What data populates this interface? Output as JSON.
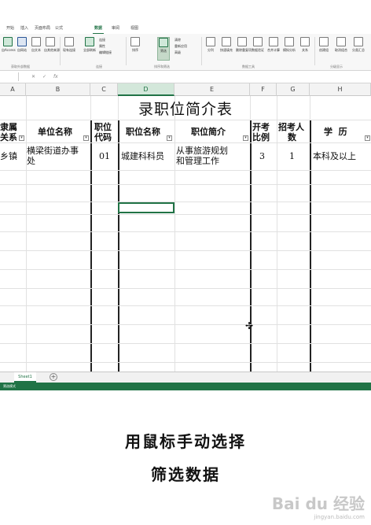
{
  "ribbon": {
    "tabs": [
      "开始",
      "插入",
      "页面布局",
      "公式",
      "数据",
      "审阅",
      "视图"
    ],
    "active_tab": "数据",
    "buttons": [
      {
        "label": "自Access"
      },
      {
        "label": "自网站"
      },
      {
        "label": "自文本"
      },
      {
        "label": "自其他来源"
      },
      {
        "label": "现有连接"
      },
      {
        "label": "全部刷新"
      },
      {
        "label": "排序"
      },
      {
        "label": "筛选"
      },
      {
        "label": "分列"
      },
      {
        "label": "快速填充"
      },
      {
        "label": "删除重复项"
      },
      {
        "label": "数据验证"
      },
      {
        "label": "合并计算"
      },
      {
        "label": "模拟分析"
      },
      {
        "label": "关系"
      },
      {
        "label": "创建组"
      },
      {
        "label": "取消组合"
      },
      {
        "label": "分类汇总"
      }
    ],
    "small_items": [
      "连接",
      "属性",
      "编辑链接",
      "清除",
      "重新应用",
      "高级"
    ],
    "group_labels": [
      "获取外部数据",
      "连接",
      "排序和筛选",
      "数据工具",
      "分级显示"
    ]
  },
  "formula_bar": {
    "fx": "fx"
  },
  "columns": [
    "A",
    "B",
    "C",
    "D",
    "E",
    "F",
    "G",
    "H"
  ],
  "active_column": "D",
  "sheet": {
    "title": "录职位简介表",
    "headers": {
      "a": [
        "隶属",
        "关系"
      ],
      "b": "单位名称",
      "c": [
        "职位",
        "代码"
      ],
      "d": "职位名称",
      "e": "职位简介",
      "f": [
        "开考",
        "比例"
      ],
      "g": [
        "招考人",
        "数"
      ],
      "h": "学  历"
    },
    "row1": {
      "a": "乡镇",
      "b": [
        "横梁街道办事",
        "处"
      ],
      "c": "01",
      "d": "城建科科员",
      "e": [
        "从事旅游规划",
        "和管理工作"
      ],
      "f": "3",
      "g": "1",
      "h": "本科及以上"
    }
  },
  "sheet_tab": "Sheet1",
  "status": "筛选模式",
  "caption": {
    "line1": "用鼠标手动选择",
    "line2": "筛选数据"
  },
  "watermark": {
    "text": "Bai du 经验",
    "sub": "jingyan.baidu.com"
  }
}
